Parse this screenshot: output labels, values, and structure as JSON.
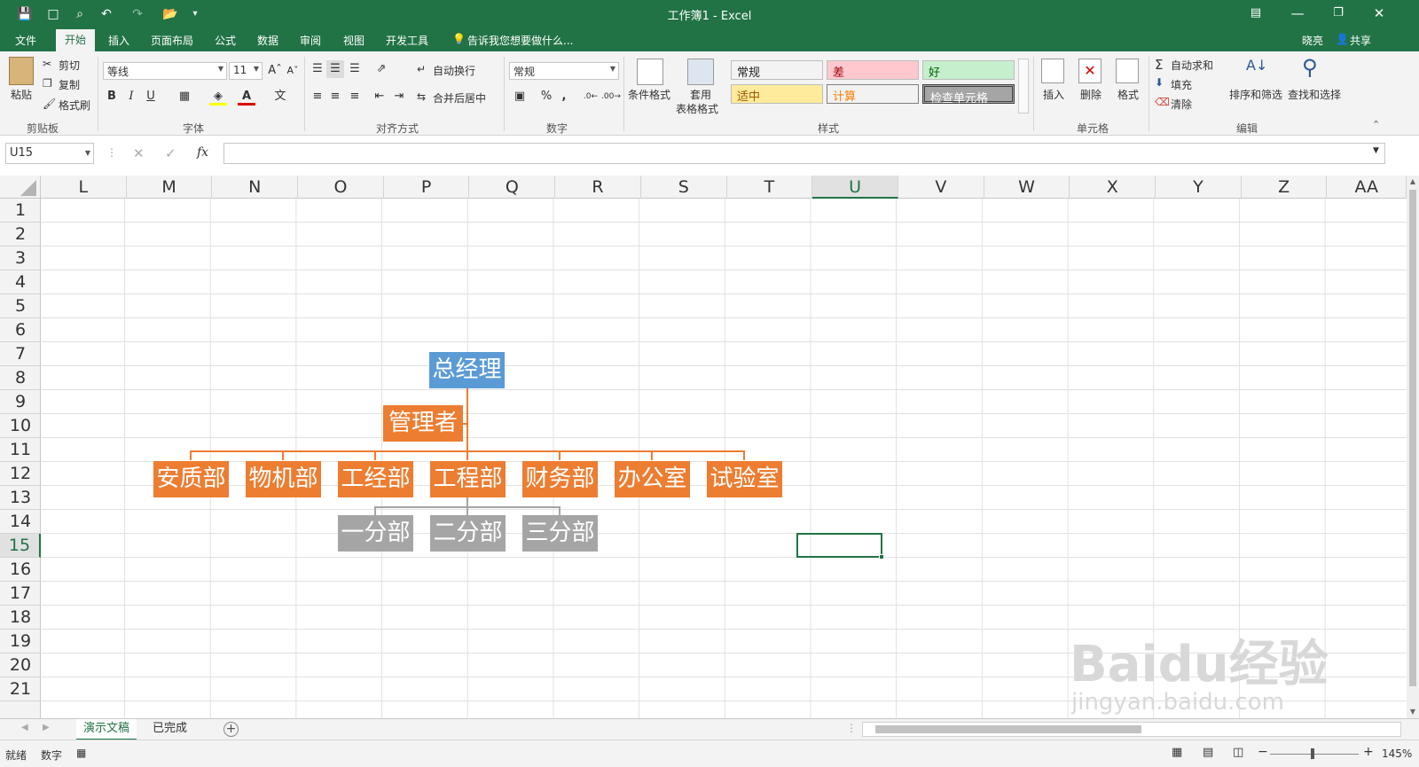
{
  "window": {
    "title": "工作簿1 - Excel"
  },
  "tabs": [
    "文件",
    "开始",
    "插入",
    "页面布局",
    "公式",
    "数据",
    "审阅",
    "视图",
    "开发工具"
  ],
  "tell_me": "告诉我您想要做什么...",
  "user": {
    "name": "晓亮",
    "share": "共享"
  },
  "clipboard": {
    "paste": "粘贴",
    "cut": "剪切",
    "copy": "复制",
    "format_painter": "格式刷",
    "group": "剪贴板"
  },
  "font": {
    "name": "等线",
    "size": "11",
    "group": "字体",
    "bold": "B",
    "italic": "I",
    "underline": "U",
    "font_color_letter": "A"
  },
  "alignment": {
    "wrap": "自动换行",
    "merge": "合并后居中",
    "group": "对齐方式"
  },
  "number": {
    "format": "常规",
    "percent": "%",
    "comma": ",",
    "group": "数字"
  },
  "styles": {
    "conditional": "条件格式",
    "table": [
      "套用",
      "表格格式"
    ],
    "cells": [
      {
        "label": "常规",
        "bg": "#ffffff",
        "fg": "#000000"
      },
      {
        "label": "差",
        "bg": "#ffc7ce",
        "fg": "#9c0006"
      },
      {
        "label": "好",
        "bg": "#c6efce",
        "fg": "#006100"
      },
      {
        "label": "适中",
        "bg": "#ffeb9c",
        "fg": "#9c5700"
      },
      {
        "label": "计算",
        "bg": "#f2f2f2",
        "fg": "#fa7d00"
      },
      {
        "label": "检查单元格",
        "bg": "#a5a5a5",
        "fg": "#ffffff"
      }
    ],
    "group": "样式"
  },
  "cells_group": {
    "insert": "插入",
    "delete": "删除",
    "format": "格式",
    "group": "单元格"
  },
  "editing": {
    "autosum": "自动求和",
    "fill": "填充",
    "clear": "清除",
    "sort": "排序和筛选",
    "find": "查找和选择",
    "group": "编辑"
  },
  "formula_bar": {
    "name_box": "U15",
    "fx": "fx",
    "value": ""
  },
  "columns": [
    "L",
    "M",
    "N",
    "O",
    "P",
    "Q",
    "R",
    "S",
    "T",
    "U",
    "V",
    "W",
    "X",
    "Y",
    "Z",
    "AA"
  ],
  "selected_column": "U",
  "rows": [
    "1",
    "2",
    "3",
    "4",
    "5",
    "6",
    "7",
    "8",
    "9",
    "10",
    "11",
    "12",
    "13",
    "14",
    "15",
    "16",
    "17",
    "18",
    "19",
    "20",
    "21"
  ],
  "selected_row": "15",
  "org_chart": {
    "top": "总经理",
    "assistant": "管理者",
    "departments": [
      "安质部",
      "物机部",
      "工经部",
      "工程部",
      "财务部",
      "办公室",
      "试验室"
    ],
    "sub_departments": [
      "一分部",
      "二分部",
      "三分部"
    ]
  },
  "sheets": {
    "items": [
      "演示文稿",
      "已完成"
    ],
    "active": "演示文稿",
    "add": "+"
  },
  "status": {
    "ready": "就绪",
    "mode": "数字",
    "zoom": "145%"
  },
  "watermark": [
    "Baidu经验",
    "jingyan.baidu.com"
  ]
}
